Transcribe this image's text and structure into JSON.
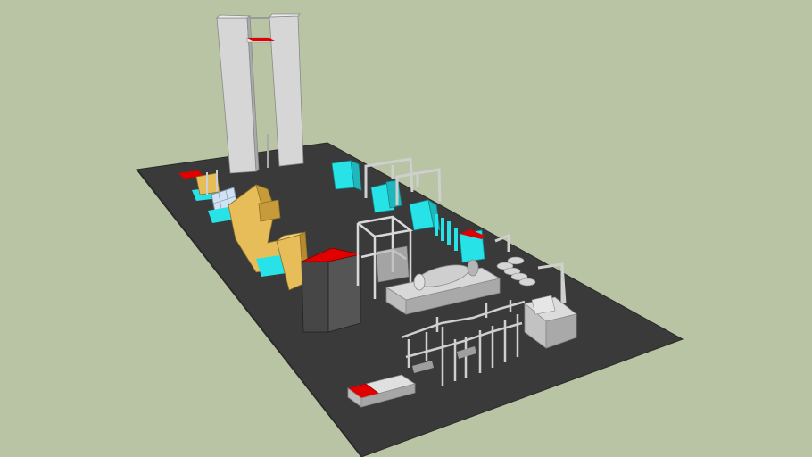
{
  "viewport": {
    "background_color": "#b8c4a3"
  },
  "model": {
    "floor_color": "#3a3a3a",
    "wall_light": "#d0d0d0",
    "wall_mid": "#b4b4b4",
    "wall_dark": "#8f8f8f",
    "accent_red": "#e00000",
    "accent_cyan": "#27e3e8",
    "accent_yellow": "#e6bd59",
    "dark_block": "#4d4d4d",
    "glass_blue": "#cfe3f5"
  }
}
